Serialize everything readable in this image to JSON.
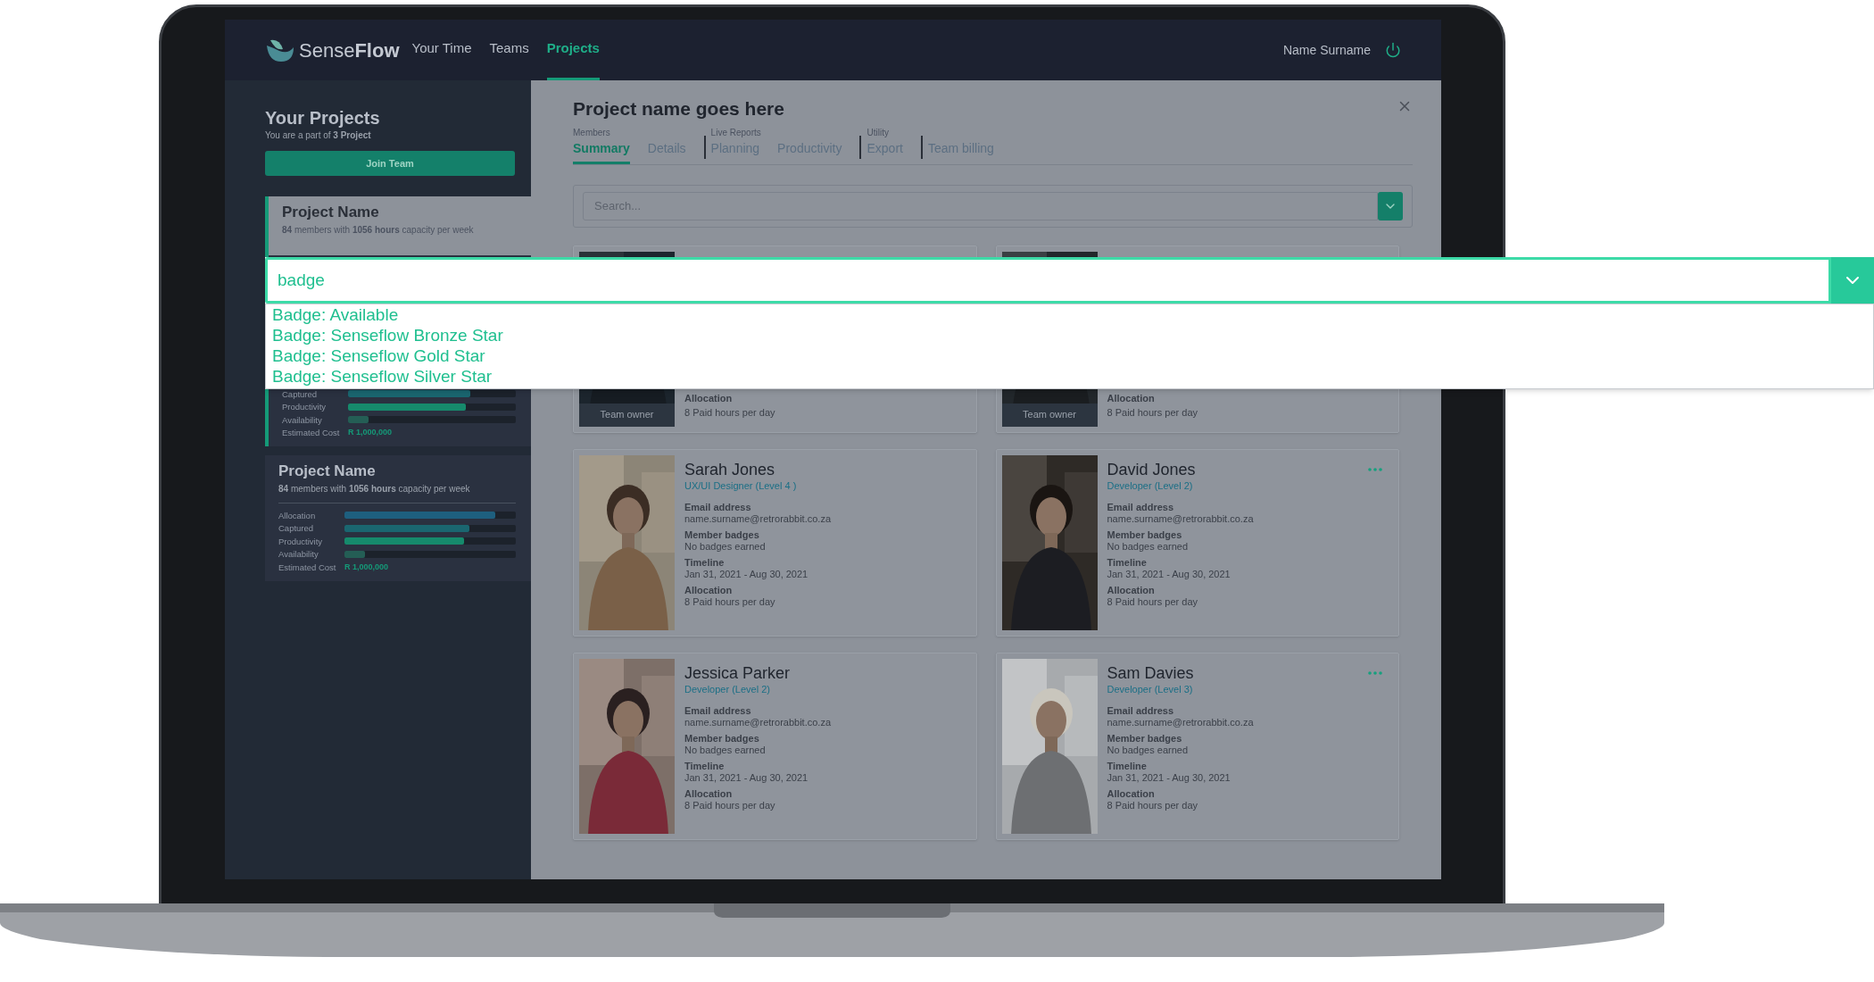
{
  "nav": {
    "logo": "Sense**Flow**",
    "items": [
      {
        "label": "Your Time",
        "selected": false
      },
      {
        "label": "Teams",
        "selected": false
      },
      {
        "label": "Projects",
        "selected": true
      }
    ],
    "user": "Name Surname"
  },
  "sidebar": {
    "title": "Your Projects",
    "subtitle": "You are a part of **3 Project**",
    "join_button": "Join Team",
    "projects": [
      {
        "name": "Project Name",
        "summary": "**84** members with **1056 hours** capacity per week",
        "selected": true,
        "covered": true,
        "rows": [
          {
            "label": "Captured",
            "level": 0.73,
            "color": "#1a6670"
          },
          {
            "label": "Productivity",
            "level": 0.7,
            "color": "#168a6c"
          },
          {
            "label": "Availability",
            "level": 0.12,
            "color": "#245e55"
          }
        ],
        "cost_label": "Estimated Cost",
        "cost": "R 1,000,000"
      },
      {
        "name": "Project Name",
        "summary": "**84** members with **1056 hours** capacity per week",
        "selected": false,
        "covered": false,
        "rows": [
          {
            "label": "Allocation",
            "level": 0.88,
            "color": "#1e5f7f"
          },
          {
            "label": "Captured",
            "level": 0.73,
            "color": "#1a6670"
          },
          {
            "label": "Productivity",
            "level": 0.7,
            "color": "#168a6c"
          },
          {
            "label": "Availability",
            "level": 0.12,
            "color": "#245e55"
          }
        ],
        "cost_label": "Estimated Cost",
        "cost": "R 1,000,000"
      }
    ]
  },
  "main": {
    "title": "Project name goes here",
    "tab_groups": [
      {
        "label": "Members",
        "tabs": [
          {
            "label": "Summary",
            "selected": true
          },
          {
            "label": "Details",
            "selected": false
          }
        ]
      },
      {
        "label": "Live Reports",
        "tabs": [
          {
            "label": "Planning",
            "selected": false
          },
          {
            "label": "Productivity",
            "selected": false
          }
        ]
      },
      {
        "label": "Utility",
        "tabs": [
          {
            "label": "Export",
            "selected": false
          }
        ]
      },
      {
        "tabs": [
          {
            "label": "Team billing",
            "selected": false
          }
        ]
      }
    ],
    "search": {
      "placeholder": "Search..."
    },
    "cards": [
      {
        "kind": "covered",
        "owner_label": "Team owner",
        "allocation_label": "Allocation",
        "allocation_value": "8 Paid hours per day"
      },
      {
        "kind": "covered",
        "owner_label": "Team owner",
        "allocation_label": "Allocation",
        "allocation_value": "8 Paid hours per day"
      },
      {
        "kind": "member",
        "name": "Sarah Jones",
        "role": "UX/UI Designer (Level 4 )",
        "fields": [
          {
            "label": "Email address",
            "value": "name.surname@retrorabbit.co.za"
          },
          {
            "label": "Member badges",
            "value": "No badges earned"
          },
          {
            "label": "Timeline",
            "value": "Jan 31, 2021 - Aug 30, 2021"
          },
          {
            "label": "Allocation",
            "value": "8 Paid hours per day"
          }
        ],
        "menu_button": false
      },
      {
        "kind": "member",
        "name": "David Jones",
        "role": "Developer (Level 2)",
        "fields": [
          {
            "label": "Email address",
            "value": "name.surname@retrorabbit.co.za"
          },
          {
            "label": "Member badges",
            "value": "No badges earned"
          },
          {
            "label": "Timeline",
            "value": "Jan 31, 2021 - Aug 30, 2021"
          },
          {
            "label": "Allocation",
            "value": "8 Paid hours per day"
          }
        ],
        "menu_button": true
      },
      {
        "kind": "member",
        "name": "Jessica Parker",
        "role": "Developer (Level 2)",
        "fields": [
          {
            "label": "Email address",
            "value": "name.surname@retrorabbit.co.za"
          },
          {
            "label": "Member badges",
            "value": "No badges earned"
          },
          {
            "label": "Timeline",
            "value": "Jan 31, 2021 - Aug 30, 2021"
          },
          {
            "label": "Allocation",
            "value": "8 Paid hours per day"
          }
        ],
        "menu_button": false
      },
      {
        "kind": "member",
        "name": "Sam Davies",
        "role": "Developer (Level 3)",
        "fields": [
          {
            "label": "Email address",
            "value": "name.surname@retrorabbit.co.za"
          },
          {
            "label": "Member badges",
            "value": "No badges earned"
          },
          {
            "label": "Timeline",
            "value": "Jan 31, 2021 - Aug 30, 2021"
          },
          {
            "label": "Allocation",
            "value": "8 Paid hours per day"
          }
        ],
        "menu_button": true
      }
    ]
  },
  "dropdown": {
    "value": "badge",
    "options": [
      "Badge: Available",
      "Badge: Senseflow Bronze Star",
      "Badge: Senseflow Gold Star",
      "Badge: Senseflow Silver Star"
    ]
  }
}
